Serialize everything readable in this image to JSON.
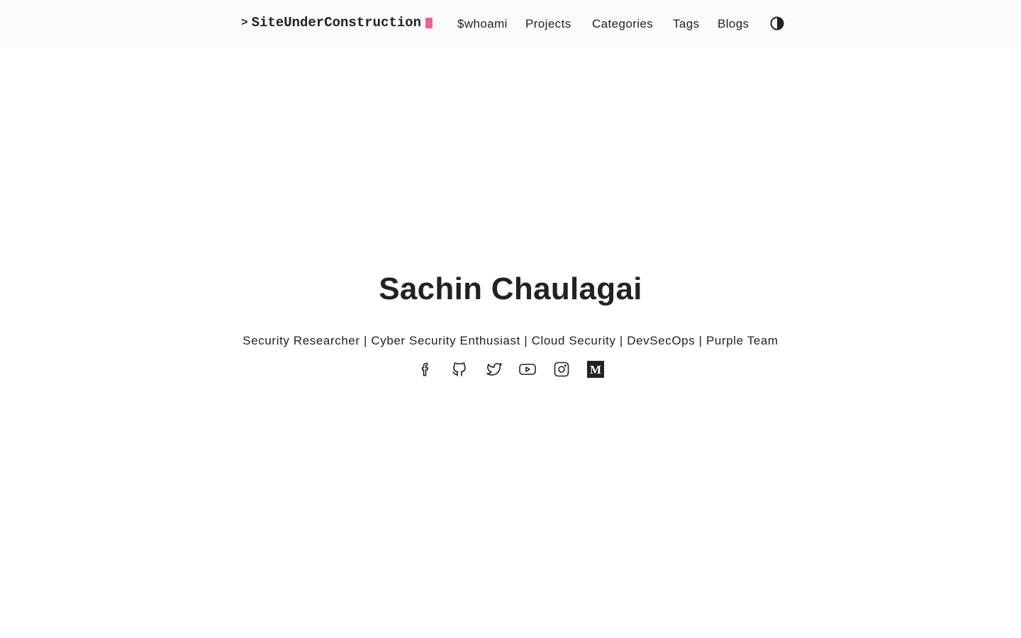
{
  "header": {
    "brand_prompt": ">",
    "brand": "SiteUnderConstruction",
    "nav": [
      {
        "label": "$whoami"
      },
      {
        "label": "Projects"
      },
      {
        "label": "Categories"
      },
      {
        "label": "Tags"
      },
      {
        "label": "Blogs"
      }
    ],
    "theme_toggle_icon": "contrast-icon"
  },
  "hero": {
    "title": "Sachin Chaulagai",
    "subtitle": "Security Researcher | Cyber Security Enthusiast | Cloud Security | DevSecOps | Purple Team"
  },
  "social": [
    {
      "icon": "facebook-icon"
    },
    {
      "icon": "github-icon"
    },
    {
      "icon": "twitter-icon"
    },
    {
      "icon": "youtube-icon"
    },
    {
      "icon": "instagram-icon"
    },
    {
      "icon": "medium-icon"
    }
  ],
  "colors": {
    "header_bg": "#fafafa",
    "text": "#222222",
    "cursor_accent": "#f06292"
  }
}
